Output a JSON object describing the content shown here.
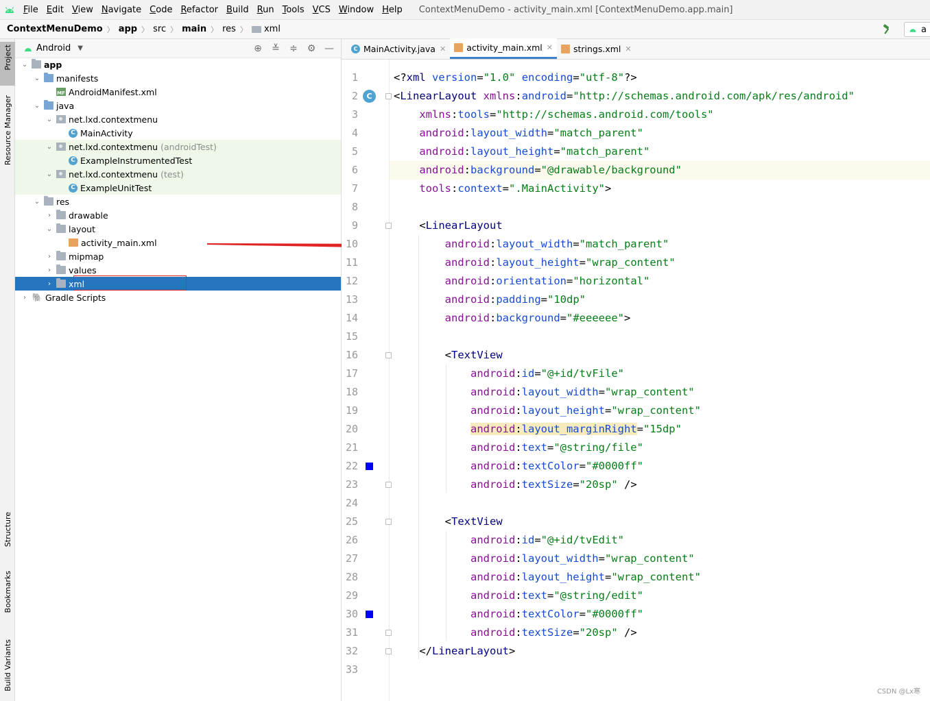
{
  "menu": {
    "items": [
      "File",
      "Edit",
      "View",
      "Navigate",
      "Code",
      "Refactor",
      "Build",
      "Run",
      "Tools",
      "VCS",
      "Window",
      "Help"
    ],
    "window_title": "ContextMenuDemo - activity_main.xml [ContextMenuDemo.app.main]"
  },
  "breadcrumb": {
    "project": "ContextMenuDemo",
    "module": "app",
    "src": "src",
    "main": "main",
    "res": "res",
    "xml": "xml",
    "run_config": "a"
  },
  "left_strip": {
    "project": "Project",
    "resource_manager": "Resource Manager",
    "structure": "Structure",
    "bookmarks": "Bookmarks",
    "build_variants": "Build Variants"
  },
  "project_panel": {
    "view_mode": "Android",
    "tree": [
      {
        "label": "app",
        "depth": 0,
        "expanded": true,
        "icon": "module-folder-icon",
        "bold": true
      },
      {
        "label": "manifests",
        "depth": 1,
        "expanded": true,
        "icon": "folder-icon"
      },
      {
        "label": "AndroidManifest.xml",
        "depth": 2,
        "icon": "manifest-icon"
      },
      {
        "label": "java",
        "depth": 1,
        "expanded": true,
        "icon": "folder-icon"
      },
      {
        "label": "net.lxd.contextmenu",
        "depth": 2,
        "expanded": true,
        "icon": "package-icon"
      },
      {
        "label": "MainActivity",
        "depth": 3,
        "icon": "class-icon"
      },
      {
        "label": "net.lxd.contextmenu",
        "suffix": "(androidTest)",
        "depth": 2,
        "expanded": true,
        "icon": "package-icon",
        "green": true
      },
      {
        "label": "ExampleInstrumentedTest",
        "depth": 3,
        "icon": "test-class-icon",
        "green": true
      },
      {
        "label": "net.lxd.contextmenu",
        "suffix": "(test)",
        "depth": 2,
        "expanded": true,
        "icon": "package-icon",
        "green": true
      },
      {
        "label": "ExampleUnitTest",
        "depth": 3,
        "icon": "test-class-icon",
        "green": true
      },
      {
        "label": "res",
        "depth": 1,
        "expanded": true,
        "icon": "res-folder-icon"
      },
      {
        "label": "drawable",
        "depth": 2,
        "expanded": false,
        "icon": "folder-icon"
      },
      {
        "label": "layout",
        "depth": 2,
        "expanded": true,
        "icon": "folder-icon"
      },
      {
        "label": "activity_main.xml",
        "depth": 3,
        "icon": "layout-xml-icon"
      },
      {
        "label": "mipmap",
        "depth": 2,
        "expanded": false,
        "icon": "folder-icon"
      },
      {
        "label": "values",
        "depth": 2,
        "expanded": false,
        "icon": "folder-icon"
      },
      {
        "label": "xml",
        "depth": 2,
        "expanded": false,
        "icon": "folder-icon",
        "selected": true
      },
      {
        "label": "Gradle Scripts",
        "depth": 0,
        "expanded": false,
        "icon": "gradle-icon"
      }
    ]
  },
  "editor": {
    "tabs": [
      {
        "label": "MainActivity.java",
        "icon": "java-class-icon",
        "active": false
      },
      {
        "label": "activity_main.xml",
        "icon": "layout-xml-icon",
        "active": true
      },
      {
        "label": "strings.xml",
        "icon": "values-xml-icon",
        "active": false
      }
    ],
    "lines": [
      "<?xml version=\"1.0\" encoding=\"utf-8\"?>",
      "<LinearLayout xmlns:android=\"http://schemas.android.com/apk/res/android\"",
      "    xmlns:tools=\"http://schemas.android.com/tools\"",
      "    android:layout_width=\"match_parent\"",
      "    android:layout_height=\"match_parent\"",
      "    android:background=\"@drawable/background\"",
      "    tools:context=\".MainActivity\">",
      "",
      "    <LinearLayout",
      "        android:layout_width=\"match_parent\"",
      "        android:layout_height=\"wrap_content\"",
      "        android:orientation=\"horizontal\"",
      "        android:padding=\"10dp\"",
      "        android:background=\"#eeeeee\">",
      "",
      "        <TextView",
      "            android:id=\"@+id/tvFile\"",
      "            android:layout_width=\"wrap_content\"",
      "            android:layout_height=\"wrap_content\"",
      "            android:layout_marginRight=\"15dp\"",
      "            android:text=\"@string/file\"",
      "            android:textColor=\"#0000ff\"",
      "            android:textSize=\"20sp\" />",
      "",
      "        <TextView",
      "            android:id=\"@+id/tvEdit\"",
      "            android:layout_width=\"wrap_content\"",
      "            android:layout_height=\"wrap_content\"",
      "            android:text=\"@string/edit\"",
      "            android:textColor=\"#0000ff\"",
      "            android:textSize=\"20sp\" />",
      "    </LinearLayout>",
      ""
    ],
    "color_swatch": "#0000ff",
    "highlighted_line": 6
  },
  "watermark": "CSDN @Lx寒",
  "colors": {
    "selection": "#2675bf",
    "test_bg": "#eef7e8",
    "annotation": "#e02424",
    "android_green": "#3ddc84"
  }
}
